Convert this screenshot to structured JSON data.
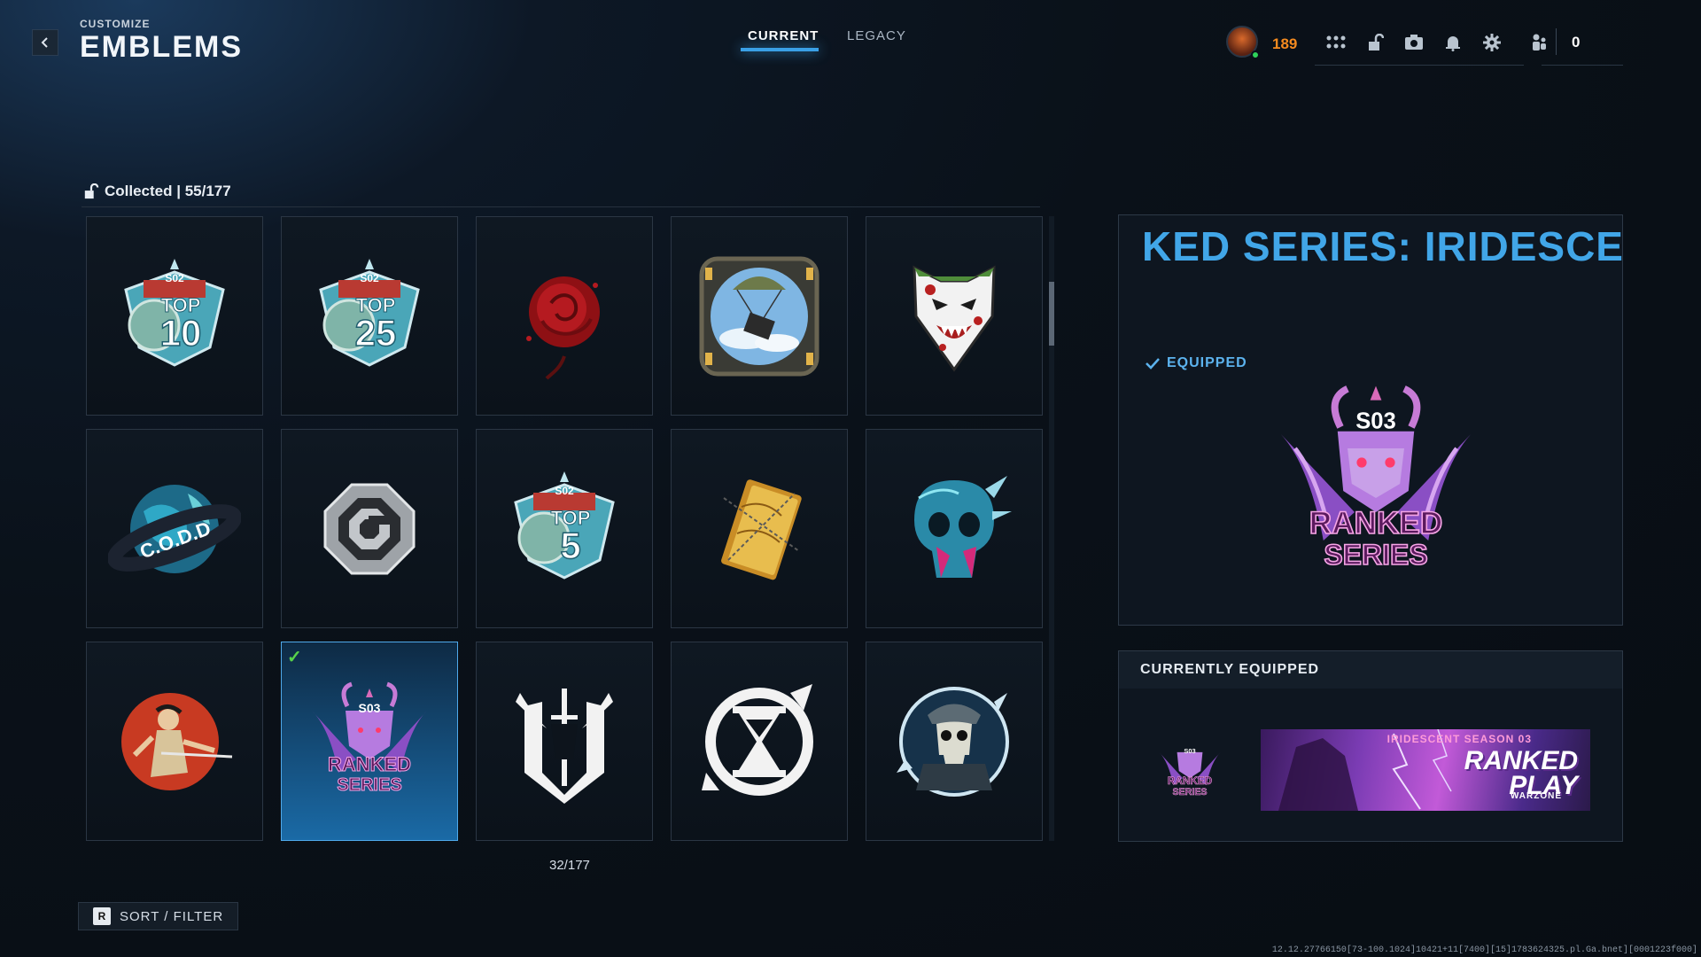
{
  "header": {
    "subtitle": "CUSTOMIZE",
    "title": "EMBLEMS"
  },
  "tabs": [
    {
      "label": "CURRENT",
      "active": true
    },
    {
      "label": "LEGACY",
      "active": false
    }
  ],
  "player": {
    "level": "189",
    "count": "0",
    "icons": [
      "grid-menu-icon",
      "lock-icon",
      "camera-icon",
      "bell-icon",
      "gear-icon",
      "party-icon"
    ]
  },
  "collection": {
    "label": "Collected | 55/177",
    "page_count": "32/177"
  },
  "emblems": [
    {
      "name": "emblem-s02-top10",
      "icon": "s02-top10-shield",
      "selected": false
    },
    {
      "name": "emblem-s02-top25",
      "icon": "s02-top25-shield",
      "selected": false
    },
    {
      "name": "emblem-red-rose",
      "icon": "red-rose",
      "selected": false
    },
    {
      "name": "emblem-supply-drop",
      "icon": "parachute-crate",
      "selected": false
    },
    {
      "name": "emblem-bloody-wolf",
      "icon": "wolf-head",
      "selected": false
    },
    {
      "name": "emblem-codd-globe",
      "icon": "globe",
      "selected": false
    },
    {
      "name": "emblem-octagon-logo",
      "icon": "octagon-logo",
      "selected": false
    },
    {
      "name": "emblem-s02-top5",
      "icon": "s02-top5-shield",
      "selected": false
    },
    {
      "name": "emblem-gold-book",
      "icon": "gold-book",
      "selected": false
    },
    {
      "name": "emblem-crystal-skull",
      "icon": "crystal-skull",
      "selected": false
    },
    {
      "name": "emblem-samurai-sun",
      "icon": "samurai",
      "selected": false
    },
    {
      "name": "emblem-s03-ranked-series",
      "icon": "ranked-series",
      "selected": true
    },
    {
      "name": "emblem-winged-sword",
      "icon": "winged-sword",
      "selected": false
    },
    {
      "name": "emblem-hourglass",
      "icon": "hourglass",
      "selected": false
    },
    {
      "name": "emblem-skull-soldier",
      "icon": "skull-soldier",
      "selected": false
    }
  ],
  "emblem_text": {
    "top10": "TOP",
    "top10_num": "10",
    "top25_num": "25",
    "top5_num": "5",
    "s02": "S02",
    "codd": "C.O.D.D",
    "s03": "S03",
    "ranked": "RANKED",
    "series": "SERIES"
  },
  "detail": {
    "title": "KED SERIES: IRIDESCENT",
    "equipped_label": "EQUIPPED"
  },
  "currently_equipped": {
    "label": "CURRENTLY EQUIPPED",
    "banner_line1": "IRIDESCENT SEASON 03",
    "banner_line2a": "RANKED",
    "banner_line2b": "PLAY",
    "banner_line3": "WARZONE"
  },
  "sort": {
    "key": "R",
    "label": "SORT / FILTER"
  },
  "debug": "12.12.27766150[73-100.1024]10421+11[7400][15]1783624325.pl.Ga.bnet][0001223f000]",
  "colors": {
    "accent_blue": "#41a6e8",
    "level_orange": "#f58a1f",
    "equipped_green": "#58d24a"
  }
}
